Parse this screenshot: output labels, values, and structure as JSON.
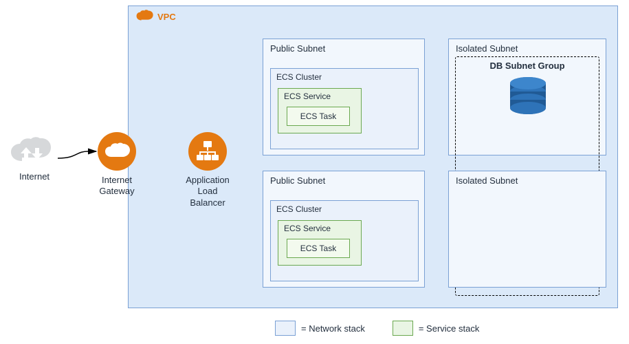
{
  "labels": {
    "internet": "Internet",
    "internet_gateway": "Internet\nGateway",
    "alb": "Application\nLoad\nBalancer",
    "vpc": "VPC",
    "public_subnet_1": "Public Subnet",
    "public_subnet_2": "Public Subnet",
    "isolated_subnet_1": "Isolated Subnet",
    "isolated_subnet_2": "Isolated Subnet",
    "ecs_cluster_1": "ECS Cluster",
    "ecs_cluster_2": "ECS Cluster",
    "ecs_service_1": "ECS Service",
    "ecs_service_2": "ECS Service",
    "ecs_task_1": "ECS Task",
    "ecs_task_2": "ECS Task",
    "db_subnet_group": "DB Subnet Group"
  },
  "legend": {
    "network_stack": "= Network stack",
    "service_stack": "= Service stack"
  },
  "icons": {
    "internet_cloud": "cloud-gray",
    "vpc_cloud": "cloud-orange",
    "igw": "cloud-orange-round",
    "alb": "hierarchy-orange-round",
    "db": "database-blue"
  },
  "colors": {
    "orange": "#e47911",
    "blue_border": "#7aa0d4",
    "blue_fill": "#f2f7fd",
    "green_border": "#6aa84f",
    "green_fill": "#e9f5e4",
    "db_blue": "#2e73b8"
  }
}
